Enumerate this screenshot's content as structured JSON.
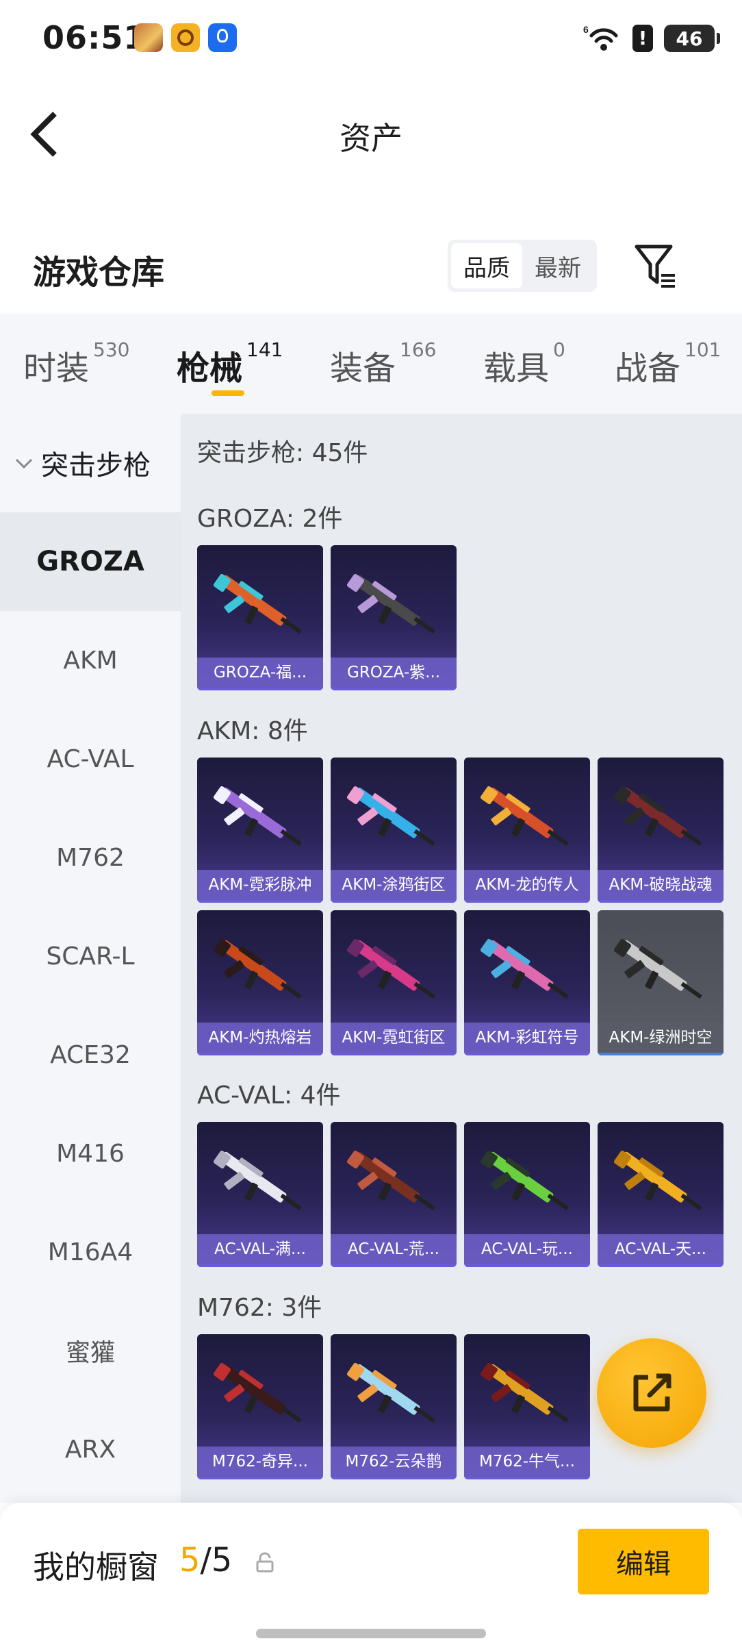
{
  "status_bar": {
    "time": "06:51",
    "battery": "46",
    "wifi_label": "6"
  },
  "header": {
    "title": "资产"
  },
  "section": {
    "title": "游戏仓库",
    "sort_options": [
      "品质",
      "最新"
    ]
  },
  "tabs": [
    {
      "label": "时装",
      "count": "530"
    },
    {
      "label": "枪械",
      "count": "141"
    },
    {
      "label": "装备",
      "count": "166"
    },
    {
      "label": "载具",
      "count": "0"
    },
    {
      "label": "战备",
      "count": "101"
    }
  ],
  "sidebar": {
    "group": "突击步枪",
    "items": [
      "GROZA",
      "AKM",
      "AC-VAL",
      "M762",
      "SCAR-L",
      "ACE32",
      "M416",
      "M16A4",
      "蜜獾",
      "ARX"
    ]
  },
  "content": {
    "summary": "突击步枪: 45件",
    "groups": [
      {
        "title": "GROZA: 2件",
        "items": [
          "GROZA-福...",
          "GROZA-紫..."
        ]
      },
      {
        "title": "AKM: 8件",
        "items": [
          "AKM-霓彩脉冲",
          "AKM-涂鸦街区",
          "AKM-龙的传人",
          "AKM-破晓战魂",
          "AKM-灼热熔岩",
          "AKM-霓虹街区",
          "AKM-彩虹符号",
          "AKM-绿洲时空"
        ]
      },
      {
        "title": "AC-VAL: 4件",
        "items": [
          "AC-VAL-满...",
          "AC-VAL-荒...",
          "AC-VAL-玩...",
          "AC-VAL-天..."
        ]
      },
      {
        "title": "M762: 3件",
        "items": [
          "M762-奇异...",
          "M762-云朵鹊",
          "M762-牛气..."
        ]
      }
    ]
  },
  "bottom": {
    "label": "我的橱窗",
    "current": "5",
    "total": "/5",
    "edit": "编辑"
  },
  "colors": {
    "accent": "#ffbb00",
    "card_top": "#1e1a3c",
    "card_bottom": "#4a3a90"
  }
}
